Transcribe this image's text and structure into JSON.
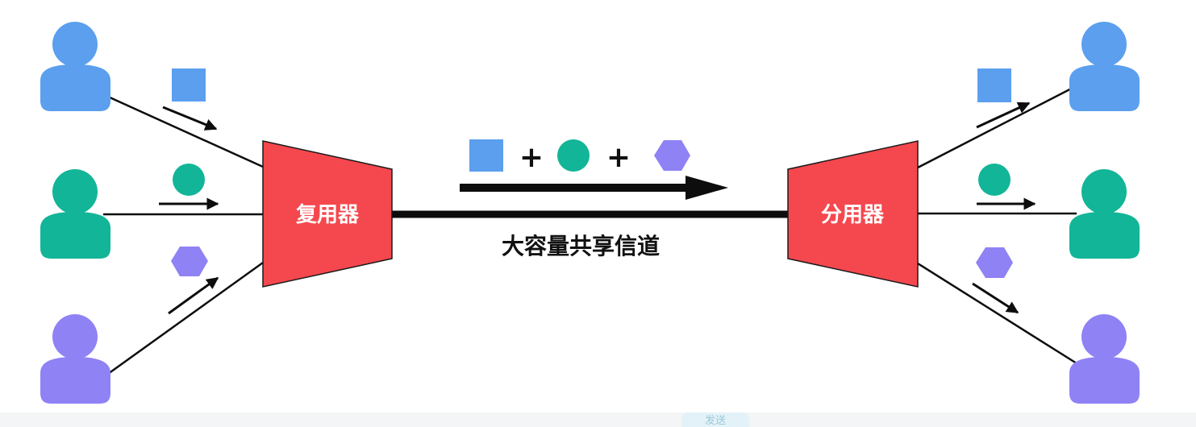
{
  "diagram": {
    "mux_label": "复用器",
    "demux_label": "分用器",
    "channel_label": "大容量共享信道",
    "plus_1": "+",
    "plus_2": "+"
  },
  "colors": {
    "blue": "#5B9FEE",
    "green": "#12B597",
    "purple": "#8F82F5",
    "red": "#F4484E",
    "line": "#0d0d0d"
  },
  "icons": {
    "user": "person-silhouette",
    "blue_signal": "square",
    "green_signal": "circle",
    "purple_signal": "hexagon"
  },
  "footer": {
    "send_tab_label": "发送"
  }
}
